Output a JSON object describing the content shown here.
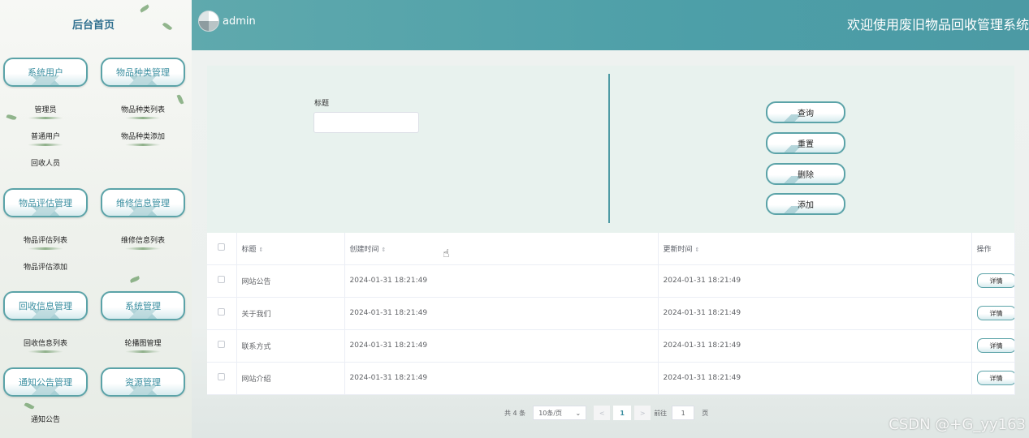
{
  "sidebar": {
    "title": "后台首页",
    "groups": [
      {
        "label": "系统用户",
        "items": [
          "管理员",
          "普通用户",
          "回收人员"
        ]
      },
      {
        "label": "物品种类管理",
        "items": [
          "物品种类列表",
          "物品种类添加"
        ]
      },
      {
        "label": "物品评估管理",
        "items": [
          "物品评估列表",
          "物品评估添加"
        ]
      },
      {
        "label": "维修信息管理",
        "items": [
          "维修信息列表"
        ]
      },
      {
        "label": "回收信息管理",
        "items": [
          "回收信息列表"
        ]
      },
      {
        "label": "系统管理",
        "items": [
          "轮播图管理"
        ]
      },
      {
        "label": "通知公告管理",
        "items": [
          "通知公告"
        ]
      },
      {
        "label": "资源管理",
        "items": []
      }
    ]
  },
  "header": {
    "user": "admin",
    "system_title": "欢迎使用废旧物品回收管理系统"
  },
  "search": {
    "title_label": "标题",
    "title_value": "",
    "buttons": {
      "query": "查询",
      "reset": "重置",
      "delete": "删除",
      "add": "添加"
    }
  },
  "table": {
    "columns": {
      "title": "标题",
      "created": "创建时间",
      "updated": "更新时间",
      "actions": "操作"
    },
    "rows": [
      {
        "title": "网站公告",
        "created": "2024-01-31 18:21:49",
        "updated": "2024-01-31 18:21:49",
        "action": "详情"
      },
      {
        "title": "关于我们",
        "created": "2024-01-31 18:21:49",
        "updated": "2024-01-31 18:21:49",
        "action": "详情"
      },
      {
        "title": "联系方式",
        "created": "2024-01-31 18:21:49",
        "updated": "2024-01-31 18:21:49",
        "action": "详情"
      },
      {
        "title": "网站介绍",
        "created": "2024-01-31 18:21:49",
        "updated": "2024-01-31 18:21:49",
        "action": "详情"
      }
    ]
  },
  "pagination": {
    "total": "共 4 条",
    "page_size": "10条/页",
    "prev": "<",
    "current": "1",
    "next": ">",
    "goto_prefix": "前往",
    "goto_value": "1",
    "goto_suffix": "页"
  },
  "watermark": "CSDN @+G_yy163",
  "colors": {
    "accent": "#4d9fa8",
    "border": "#5ba3a8"
  },
  "icons": {
    "sort": "sort-caret-icon",
    "avatar": "avatar-icon",
    "cursor": "hand-pointer-icon"
  }
}
